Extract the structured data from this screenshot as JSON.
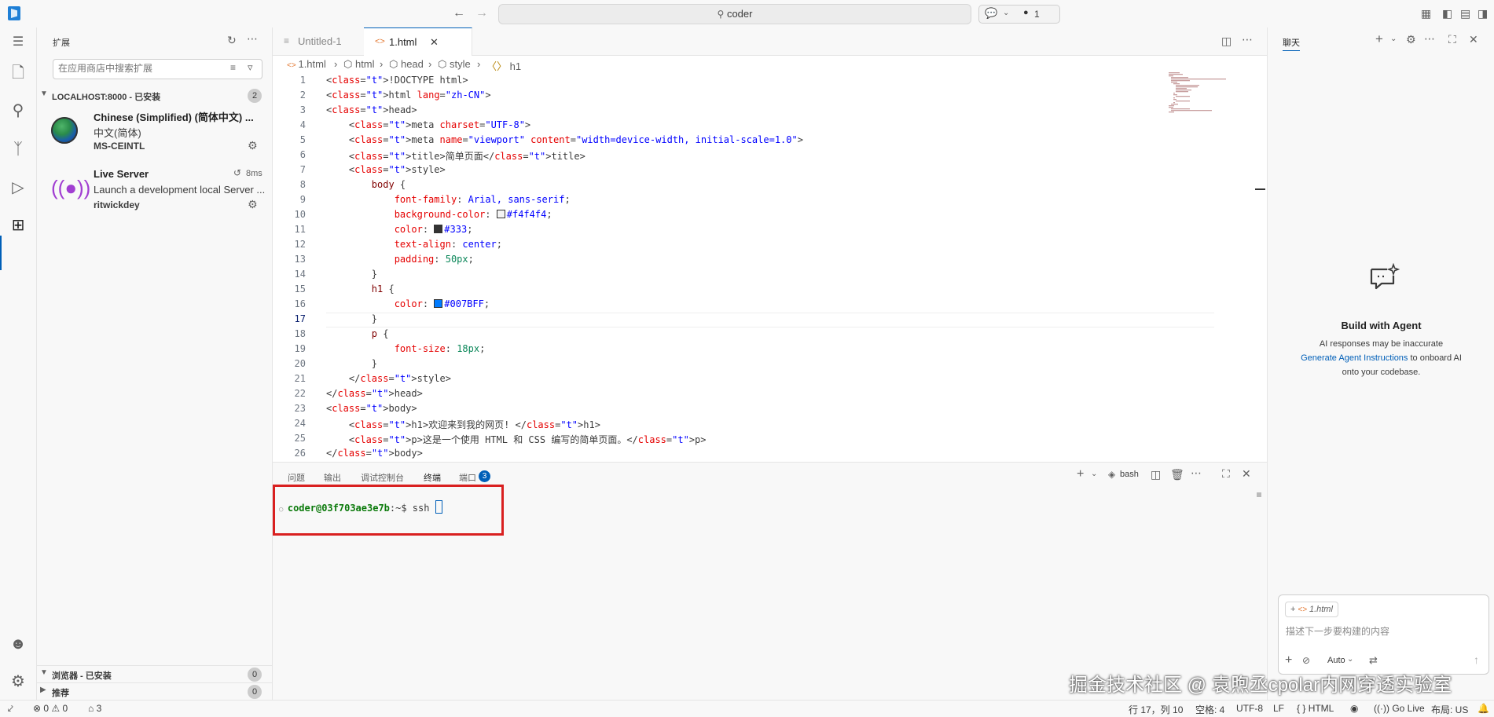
{
  "titlebar": {
    "search_text": "coder",
    "status_count": "1"
  },
  "sidebar": {
    "title": "扩展",
    "search_placeholder": "在应用商店中搜索扩展",
    "section_localhost": {
      "label": "LOCALHOST:8000 - 已安装",
      "count": "2"
    },
    "extensions": [
      {
        "name": "Chinese (Simplified) (简体中文) ...",
        "desc": "中文(简体)",
        "publisher": "MS-CEINTL",
        "icon": "globe-icon"
      },
      {
        "name": "Live Server",
        "desc": "Launch a development local Server ...",
        "publisher": "ritwickdey",
        "time": "8ms",
        "icon": "broadcast-icon"
      }
    ],
    "section_browser": {
      "label": "浏览器 - 已安装",
      "count": "0"
    },
    "section_recommended": {
      "label": "推荐",
      "count": "0"
    }
  },
  "tabs": [
    {
      "label": "Untitled-1",
      "active": false
    },
    {
      "label": "1.html",
      "active": true
    }
  ],
  "breadcrumb": [
    "1.html",
    "html",
    "head",
    "style",
    "h1"
  ],
  "editor": {
    "current_line": 17,
    "line_numbers": [
      "1",
      "2",
      "3",
      "4",
      "5",
      "6",
      "7",
      "8",
      "9",
      "10",
      "11",
      "12",
      "13",
      "14",
      "15",
      "16",
      "17",
      "18",
      "19",
      "20",
      "21",
      "22",
      "23",
      "24",
      "25",
      "26"
    ],
    "lines": [
      "<!DOCTYPE html>",
      "<html lang=\"zh-CN\">",
      "<head>",
      "    <meta charset=\"UTF-8\">",
      "    <meta name=\"viewport\" content=\"width=device-width, initial-scale=1.0\">",
      "    <title>简单页面</title>",
      "    <style>",
      "        body {",
      "            font-family: Arial, sans-serif;",
      "            background-color: #f4f4f4;",
      "            color: #333;",
      "            text-align: center;",
      "            padding: 50px;",
      "        }",
      "        h1 {",
      "            color: #007BFF;",
      "        }",
      "        p {",
      "            font-size: 18px;",
      "        }",
      "    </style>",
      "</head>",
      "<body>",
      "    <h1>欢迎来到我的网页! </h1>",
      "    <p>这是一个使用 HTML 和 CSS 编写的简单页面。</p>",
      "</body>"
    ]
  },
  "panel": {
    "tabs": [
      "问题",
      "输出",
      "调试控制台",
      "终端",
      "端口"
    ],
    "active_tab": "终端",
    "ports_count": "3",
    "shell": "bash",
    "prompt_user": "coder@03f703ae3e7b",
    "prompt_path": ":~$ ",
    "command": "ssh"
  },
  "chat": {
    "tab": "聊天",
    "heading": "Build with Agent",
    "line1": "AI responses may be inaccurate",
    "link": "Generate Agent Instructions",
    "line2_rest": " to onboard AI",
    "line3": "onto your codebase.",
    "attachment": "1.html",
    "input_placeholder": "描述下一步要构建的内容",
    "mode": "Auto"
  },
  "statusbar": {
    "errors": "0",
    "warnings": "0",
    "ports": "3",
    "position": "行 17，列 10",
    "spaces": "空格: 4",
    "encoding": "UTF-8",
    "eol": "LF",
    "language": "HTML",
    "golive": "Go Live",
    "layout": "布局: US"
  },
  "watermark": "掘金技术社区 @ 袁煦丞cpolar内网穿透实验室",
  "colors": {
    "accent": "#005fb8",
    "highlight_box": "#d92020"
  }
}
